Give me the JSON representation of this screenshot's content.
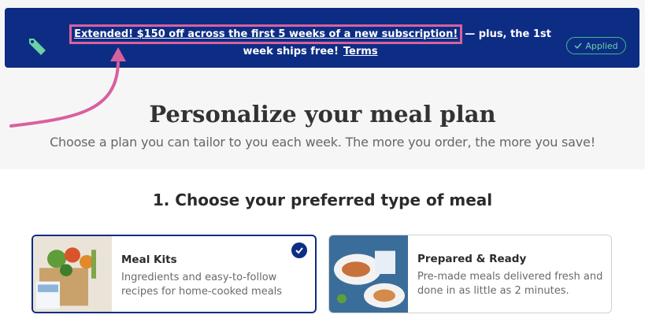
{
  "promo": {
    "highlight_text": "Extended! $150 off across the first 5 weeks of a new subscription!",
    "rest_text": "— plus, the 1st week ships free!",
    "terms_label": "Terms",
    "applied_label": "Applied",
    "colors": {
      "banner_bg": "#0d2d84",
      "highlight_border": "#d9609f",
      "applied_green": "#3fb98b"
    }
  },
  "hero": {
    "title": "Personalize your meal plan",
    "subtitle": "Choose a plan you can tailor to you each week. The more you order, the more you save!"
  },
  "step": {
    "title": "1. Choose your preferred type of meal"
  },
  "meal_types": [
    {
      "title": "Meal Kits",
      "description": "Ingredients and easy-to-follow recipes for home-cooked meals",
      "selected": true
    },
    {
      "title": "Prepared & Ready",
      "description": "Pre-made meals delivered fresh and done in as little as 2 minutes.",
      "selected": false
    }
  ],
  "icons": [
    "tag-icon",
    "checkmark-icon",
    "annotation-arrow"
  ]
}
